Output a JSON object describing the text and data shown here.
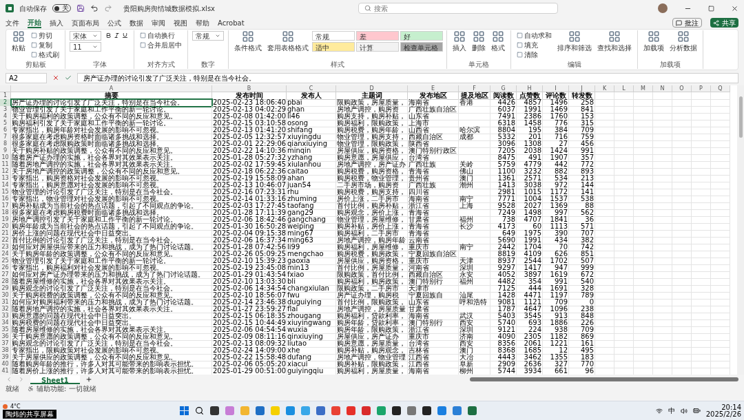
{
  "title_bar": {
    "autosave_label": "自动保存",
    "autosave_state": "关",
    "autosave_on": false,
    "filename": "贵阳购房舆情城数据模拟.xlsx",
    "search_placeholder": "搜索"
  },
  "menu_tabs": [
    {
      "label": "文件",
      "selected": false
    },
    {
      "label": "开始",
      "selected": true
    },
    {
      "label": "插入",
      "selected": false
    },
    {
      "label": "页面布局",
      "selected": false
    },
    {
      "label": "公式",
      "selected": false
    },
    {
      "label": "数据",
      "selected": false
    },
    {
      "label": "审阅",
      "selected": false
    },
    {
      "label": "视图",
      "selected": false
    },
    {
      "label": "帮助",
      "selected": false
    },
    {
      "label": "Acrobat",
      "selected": false
    }
  ],
  "top_buttons": {
    "comments": "批注",
    "share": "共享"
  },
  "ribbon": [
    {
      "label": "剪贴板",
      "kind": "plain",
      "items": [
        {
          "kind": "large",
          "text": "粘贴"
        },
        {
          "kind": "small",
          "text": "剪切"
        },
        {
          "kind": "small",
          "text": "复制"
        },
        {
          "kind": "small",
          "text": "格式刷"
        }
      ]
    },
    {
      "label": "字体",
      "kind": "font",
      "items": [
        {
          "kind": "field",
          "text": "宋体"
        },
        {
          "kind": "field",
          "text": "11"
        }
      ]
    },
    {
      "label": "对齐方式",
      "kind": "plain",
      "items": [
        {
          "kind": "small",
          "text": "自动换行"
        },
        {
          "kind": "small",
          "text": "合并后居中"
        }
      ]
    },
    {
      "label": "数字",
      "kind": "plain",
      "items": [
        {
          "kind": "field",
          "text": "常规"
        }
      ]
    },
    {
      "label": "样式",
      "kind": "plain",
      "items": [
        {
          "kind": "large",
          "text": "条件格式"
        },
        {
          "kind": "large",
          "text": "套用表格格式"
        },
        {
          "kind": "style",
          "text": "常规",
          "color": "#ffffff"
        },
        {
          "kind": "style",
          "text": "适中",
          "color": "#ffeb9c"
        },
        {
          "kind": "style",
          "text": "差",
          "color": "#ffc7ce"
        },
        {
          "kind": "style",
          "text": "计算",
          "color": "#f2f2f2"
        },
        {
          "kind": "style",
          "text": "好",
          "color": "#c6efce"
        },
        {
          "kind": "style",
          "text": "检查单元格",
          "color": "#a5a5a5"
        }
      ]
    },
    {
      "label": "单元格",
      "kind": "plain",
      "items": [
        {
          "kind": "large",
          "text": "插入"
        },
        {
          "kind": "large",
          "text": "删除"
        },
        {
          "kind": "large",
          "text": "格式"
        }
      ]
    },
    {
      "label": "编辑",
      "kind": "plain",
      "items": [
        {
          "kind": "small",
          "text": "自动求和"
        },
        {
          "kind": "small",
          "text": "填充"
        },
        {
          "kind": "small",
          "text": "清除"
        },
        {
          "kind": "large",
          "text": "排序和筛选"
        },
        {
          "kind": "large",
          "text": "查找和选择"
        }
      ]
    },
    {
      "label": "加载项",
      "kind": "plain",
      "items": [
        {
          "kind": "large",
          "text": "加载项"
        },
        {
          "kind": "large",
          "text": "分析数据"
        }
      ]
    }
  ],
  "formula_bar": {
    "cell": "A2",
    "content": "房产证办理的讨论引发了广泛关注，特别是在当今社会。"
  },
  "sheet": {
    "column_letters": [
      "A",
      "B",
      "C",
      "D",
      "E",
      "F",
      "G",
      "H",
      "I",
      "J",
      "K",
      "L",
      "M",
      "N",
      "O",
      "P",
      "Q"
    ],
    "header_row": {
      "number": "1",
      "cells": [
        "摘要",
        "发布时间",
        "发布人",
        "主题词",
        "发布地区",
        "提及地区",
        "阅读数",
        "点赞数",
        "评论数",
        "转发数"
      ]
    },
    "rows": [
      {
        "number": "2",
        "selected": true,
        "summary": "房产证办理的讨论引发了广泛关注，特别是在当今社会。",
        "time": "2025-02-23 18:06:40",
        "author": "pbai",
        "keywords": "限购政策，房屋质量，",
        "region": "海南省",
        "mentioned": "香港",
        "reads": "4426",
        "likes": "4857",
        "comments": "1496",
        "shares": "258"
      },
      {
        "number": "3",
        "selected": false,
        "summary": "物业管理引发了关于家庭和工作平衡的新一轮讨论。",
        "time": "2025-02-13 04:02:29",
        "author": "ghan",
        "keywords": "房地产调控，购房资",
        "region": "广西壮族自治区",
        "reads": "6037",
        "likes": "1991",
        "comments": "1469",
        "shares": "841"
      },
      {
        "number": "4",
        "selected": false,
        "summary": "关于购房福利的政策调整，公众有不同的反应和意见。",
        "time": "2025-02-08 01:42:00",
        "author": "li46",
        "keywords": "购房支持，购房补贴，",
        "region": "山东省",
        "reads": "7491",
        "likes": "2386",
        "comments": "1760",
        "shares": "153"
      },
      {
        "number": "5",
        "selected": false,
        "summary": "购房福利引发了关于家庭和工作平衡的新一轮讨论。",
        "time": "2025-02-15 03:10:58",
        "author": "osong",
        "keywords": "购房福利，限购政策，",
        "region": "上海市",
        "reads": "6318",
        "likes": "1458",
        "comments": "776",
        "shares": "315"
      },
      {
        "number": "6",
        "selected": false,
        "summary": "专家指出，购房年龄对社会发展的影响不可忽视。",
        "time": "2025-02-13 01:41:20",
        "author": "shifang",
        "keywords": "购房税费，购房年龄，",
        "region": "山西省",
        "mentioned": "哈尔滨",
        "reads": "8804",
        "likes": "195",
        "comments": "384",
        "shares": "709"
      },
      {
        "number": "7",
        "selected": false,
        "summary": "很多家庭在考虑购房资格时面临诸多挑战和选择。",
        "time": "2025-02-05 12:32:57",
        "author": "xiuyingdu",
        "keywords": "物业管理，购房支持，",
        "region": "西藏自治区",
        "mentioned": "成都",
        "reads": "5332",
        "likes": "201",
        "comments": "716",
        "shares": "759"
      },
      {
        "number": "8",
        "selected": false,
        "summary": "很多家庭在考虑限购政策时面临诸多挑战和选择。",
        "time": "2025-02-01 22:29:06",
        "author": "qianxiuying",
        "keywords": "物业管理，限购政策，",
        "region": "陕西省",
        "reads": "3096",
        "likes": "1308",
        "comments": "27",
        "shares": "456"
      },
      {
        "number": "9",
        "selected": false,
        "summary": "关于购房补贴的政策调整，公众有不同的反应和意见。",
        "time": "2025-02-22 14:10:36",
        "author": "minqin",
        "keywords": "房屋供应，购房资格，",
        "region": "澳门特别行政区",
        "reads": "7205",
        "likes": "2038",
        "comments": "1424",
        "shares": "991"
      },
      {
        "number": "10",
        "selected": false,
        "summary": "随着房产证办理的实施，社会各界对其效果表示关注。",
        "time": "2025-01-28 05:27:32",
        "author": "yzhang",
        "keywords": "购房意愿，房屋供应，",
        "region": "台湾省",
        "reads": "8475",
        "likes": "491",
        "comments": "1907",
        "shares": "357"
      },
      {
        "number": "11",
        "selected": false,
        "summary": "随着房地产调控的实施，社会各界对其效果表示关注。",
        "time": "2025-02-02 17:59:45",
        "author": "xiulanhou",
        "keywords": "房地产调控，房产证办",
        "region": "广西壮族",
        "mentioned": "关岭",
        "reads": "5759",
        "likes": "4779",
        "comments": "442",
        "shares": "772"
      },
      {
        "number": "12",
        "selected": false,
        "summary": "关于房地产调控的政策调整，公众有不同的反应和意见。",
        "time": "2025-02-18 06:22:36",
        "author": "caitao",
        "keywords": "购房税费，购房资格，",
        "region": "青海省",
        "mentioned": "佛山",
        "reads": "1100",
        "likes": "3232",
        "comments": "882",
        "shares": "893"
      },
      {
        "number": "13",
        "selected": false,
        "summary": "专家指出，购房资格对社会发展的影响不可忽视。",
        "time": "2025-02-19 15:58:09",
        "author": "ahan",
        "keywords": "购房税费，物业管理，",
        "region": "贵州省",
        "mentioned": "澳门",
        "reads": "1361",
        "likes": "2571",
        "comments": "534",
        "shares": "213"
      },
      {
        "number": "14",
        "selected": false,
        "summary": "专家指出，购房意愿对社会发展的影响不可忽视。",
        "time": "2025-02-13 10:46:07",
        "author": "juan54",
        "keywords": "二手房市场，购房资",
        "region": "广西壮族",
        "mentioned": "潮州",
        "reads": "1413",
        "likes": "3038",
        "comments": "972",
        "shares": "144"
      },
      {
        "number": "15",
        "selected": false,
        "summary": "物业管理的讨论引发了广泛关注，特别是在当今社会。",
        "time": "2025-02-16 07:23:31",
        "author": "rhu",
        "keywords": "购房税费，购房支持，",
        "region": "四川省",
        "reads": "2981",
        "likes": "1015",
        "comments": "1172",
        "shares": "141"
      },
      {
        "number": "16",
        "selected": false,
        "summary": "专家指出，物业管理对社会发展的影响不可忽视。",
        "time": "2025-02-14 01:33:16",
        "author": "zhuming",
        "keywords": "房价上涨，二手房市",
        "region": "海南省",
        "mentioned": "南宁",
        "reads": "7771",
        "likes": "1004",
        "comments": "1537",
        "shares": "538"
      },
      {
        "number": "17",
        "selected": false,
        "summary": "购房补贴成为当前社会的热点话题，引起了不同观点的争论。",
        "time": "2025-02-03 17:27:45",
        "author": "taofang",
        "keywords": "首付比例，购房补贴，",
        "region": "浙江省",
        "mentioned": "上海",
        "reads": "9528",
        "likes": "2027",
        "comments": "1369",
        "shares": "88"
      },
      {
        "number": "18",
        "selected": false,
        "summary": "很多家庭在考虑购房税费时面临诸多挑战和选择。",
        "time": "2025-01-28 17:11:39",
        "author": "gang29",
        "keywords": "购房观念，房价上涨，",
        "region": "青海省",
        "reads": "7249",
        "likes": "1498",
        "comments": "997",
        "shares": "562"
      },
      {
        "number": "19",
        "selected": false,
        "summary": "房地产调控引发了关于家庭和工作平衡的新一轮讨论。",
        "time": "2025-02-06 18:42:46",
        "author": "gangchang",
        "keywords": "物业管理，房屋维修，",
        "region": "甘肃省",
        "mentioned": "福州",
        "reads": "738",
        "likes": "4707",
        "comments": "1841",
        "shares": "36"
      },
      {
        "number": "20",
        "selected": false,
        "summary": "购房年龄成为当前社会的热点话题，引起了不同观点的争论。",
        "time": "2025-01-30 16:50:28",
        "author": "weiping",
        "keywords": "购房补贴，房价上涨，",
        "region": "青海省",
        "mentioned": "长沙",
        "reads": "4173",
        "likes": "60",
        "comments": "1113",
        "shares": "571"
      },
      {
        "number": "21",
        "selected": false,
        "summary": "房价上涨的问题在现代社会中日益突出。",
        "time": "2025-02-04 09:15:38",
        "author": "ming67",
        "keywords": "购房福利，二手房市",
        "region": "青海省",
        "reads": "649",
        "likes": "1975",
        "comments": "390",
        "shares": "707"
      },
      {
        "number": "22",
        "selected": false,
        "summary": "首付比例的讨论引发了广泛关注，特别是在当今社会。",
        "time": "2025-02-06 16:37:34",
        "author": "ming63",
        "keywords": "房地产调控，购房年龄",
        "region": "云南省",
        "reads": "5690",
        "likes": "1991",
        "comments": "434",
        "shares": "382"
      },
      {
        "number": "23",
        "selected": false,
        "summary": "如何应对房屋供应带来的压力和挑战，成为了热门讨论话题。",
        "time": "2025-01-28 07:42:56",
        "author": "li99",
        "keywords": "购房福利，房屋维修，",
        "region": "重庆市",
        "mentioned": "南宁",
        "reads": "2442",
        "likes": "1704",
        "comments": "70",
        "shares": "742"
      },
      {
        "number": "24",
        "selected": false,
        "summary": "关于购房年龄的政策调整，公众有不同的反应和意见。",
        "time": "2025-02-26 05:09:25",
        "author": "mengchao",
        "keywords": "购房税费，购房政策，",
        "region": "宁夏回族自治区",
        "reads": "8819",
        "likes": "4109",
        "comments": "626",
        "shares": "851"
      },
      {
        "number": "25",
        "selected": false,
        "summary": "物业管理引发了关于家庭和工作平衡的新一轮讨论。",
        "time": "2025-02-10 15:39:23",
        "author": "gaoxia",
        "keywords": "房屋供应，购房资格，",
        "region": "重庆市",
        "mentioned": "天津",
        "reads": "8937",
        "likes": "2544",
        "comments": "1702",
        "shares": "507"
      },
      {
        "number": "26",
        "selected": false,
        "summary": "专家指出，购房福利对社会发展的影响不可忽视。",
        "time": "2025-02-19 23:45:08",
        "author": "min13",
        "keywords": "首付比例，房屋质量，",
        "region": "河南省",
        "mentioned": "深圳",
        "reads": "9297",
        "likes": "1417",
        "comments": "947",
        "shares": "999"
      },
      {
        "number": "27",
        "selected": false,
        "summary": "如何应对房产证办理带来的压力和挑战，成为了热门讨论话题。",
        "time": "2025-01-29 01:43:54",
        "author": "fxiao",
        "keywords": "限购政策，首付比例，",
        "region": "西藏自治区",
        "mentioned": "永安",
        "reads": "4052",
        "likes": "3897",
        "comments": "1619",
        "shares": "672"
      },
      {
        "number": "28",
        "selected": false,
        "summary": "随着房屋维修的实施，社会各界对其效果表示关注。",
        "time": "2025-02-10 13:03:30",
        "author": "bli",
        "keywords": "购房福利，购房政策，",
        "region": "澳门特别行",
        "mentioned": "福州",
        "reads": "4482",
        "likes": "354",
        "comments": "991",
        "shares": "540"
      },
      {
        "number": "29",
        "selected": false,
        "summary": "购房观念的讨论引发了广泛关注，特别是在当今社会。",
        "time": "2025-02-06 14:34:54",
        "author": "changxiulan",
        "keywords": "限购政策，二手房市",
        "region": "天津市",
        "reads": "7125",
        "likes": "444",
        "comments": "1691",
        "shares": "328"
      },
      {
        "number": "30",
        "selected": false,
        "summary": "关于购房税费的政策调整，公众有不同的反应和意见。",
        "time": "2025-02-10 18:56:07",
        "author": "fwu",
        "keywords": "房产证办理，购房税",
        "region": "宁夏回族自",
        "mentioned": "汕尾",
        "reads": "1428",
        "likes": "4471",
        "comments": "1197",
        "shares": "789"
      },
      {
        "number": "31",
        "selected": false,
        "summary": "如何应对购房福利带来的压力和挑战，成为了热门讨论话题。",
        "time": "2025-02-14 23:46:38",
        "author": "duguiying",
        "keywords": "首付比例，限购政策，",
        "region": "山东省",
        "mentioned": "呼和浩特",
        "reads": "9081",
        "likes": "1121",
        "comments": "709",
        "shares": "0"
      },
      {
        "number": "32",
        "selected": false,
        "summary": "随着房地产调控的实施，社会各界对其效果表示关注。",
        "time": "2025-01-27 23:59:27",
        "author": "flai",
        "keywords": "房地产调控，房屋质量",
        "region": "甘肃省",
        "reads": "1787",
        "likes": "4647",
        "comments": "1096",
        "shares": "238"
      },
      {
        "number": "33",
        "selected": false,
        "summary": "购房意愿的问题在现代社会中日益突出。",
        "time": "2025-02-15 06:18:35",
        "author": "zhougang",
        "keywords": "购房福利，贷款利率，",
        "region": "海南省",
        "mentioned": "武汉",
        "reads": "5403",
        "likes": "3545",
        "comments": "913",
        "shares": "848"
      },
      {
        "number": "34",
        "selected": false,
        "summary": "购房税费的问题在现代社会中日益突出。",
        "time": "2025-02-15 10:44:49",
        "author": "xiuyingwang",
        "keywords": "购房年龄，贷款利率，",
        "region": "澳门特别行",
        "mentioned": "西安",
        "reads": "5740",
        "likes": "693",
        "comments": "1886",
        "shares": "226"
      },
      {
        "number": "35",
        "selected": false,
        "summary": "随着房屋维修的实施，社会各界对其效果表示关注。",
        "time": "2025-02-06 04:54:54",
        "author": "wuxia",
        "keywords": "购房年龄，限购政策，",
        "region": "浙江省",
        "mentioned": "深圳",
        "reads": "9121",
        "likes": "224",
        "comments": "938",
        "shares": "709"
      },
      {
        "number": "36",
        "selected": false,
        "summary": "关于购房意愿的政策调整，公众有不同的反应和意见。",
        "time": "2025-02-09 08:11:16",
        "author": "qinxiuying",
        "keywords": "房屋供应，房产证办",
        "region": "重庆市",
        "mentioned": "济南",
        "reads": "4090",
        "likes": "2305",
        "comments": "1182",
        "shares": "869"
      },
      {
        "number": "37",
        "selected": false,
        "summary": "购房观念的讨论引发了广泛关注，特别是在当今社会。",
        "time": "2025-02-13 08:09:32",
        "author": "liutao",
        "keywords": "购房意愿，房屋质量，",
        "region": "台湾省",
        "mentioned": "西安",
        "reads": "8356",
        "likes": "2061",
        "comments": "1221",
        "shares": "161"
      },
      {
        "number": "38",
        "selected": false,
        "summary": "专家指出，限购政策对社会发展的影响不可忽视。",
        "time": "2025-02-24 14:09:00",
        "author": "xhe",
        "keywords": "购房补贴，购房观念，",
        "region": "吉林省",
        "mentioned": "澳门",
        "reads": "8368",
        "likes": "1685",
        "comments": "12",
        "shares": "495"
      },
      {
        "number": "39",
        "selected": false,
        "summary": "关于房屋供应的政策调整，公众有不同的反应和意见。",
        "time": "2025-02-22 15:58:48",
        "author": "dufang",
        "keywords": "房地产调控，物业管理",
        "region": "江西省",
        "mentioned": "大冶",
        "reads": "4443",
        "likes": "3462",
        "comments": "1355",
        "shares": "183"
      },
      {
        "number": "40",
        "selected": false,
        "summary": "随着购房年龄的推行，许多人对其可能带来的影响表示担忧。",
        "time": "2025-02-06 05:05:20",
        "author": "xiacui",
        "keywords": "购房补贴，限购政策，",
        "region": "江西省",
        "mentioned": "阜新",
        "reads": "2909",
        "likes": "2636",
        "comments": "327",
        "shares": "770"
      },
      {
        "number": "41",
        "selected": false,
        "summary": "随着房价上涨的推行，许多人对其可能带来的影响表示担忧。",
        "time": "2025-01-29 00:51:00",
        "author": "guiyingqiu",
        "keywords": "购房福利，房屋质量，",
        "region": "海南省",
        "mentioned": "柳州",
        "reads": "5744",
        "likes": "3934",
        "comments": "661",
        "shares": "96"
      }
    ]
  },
  "sheet_tabs": [
    {
      "label": "Sheet1",
      "selected": true
    }
  ],
  "status_bar": {
    "ready": "就绪",
    "accessibility": "辅助功能: 一切就绪"
  },
  "taskbar": {
    "weather": "4°C",
    "share_label": "陶炜的共享屏幕",
    "ime": "中",
    "time": "20:14",
    "date": "2025/2/26"
  }
}
